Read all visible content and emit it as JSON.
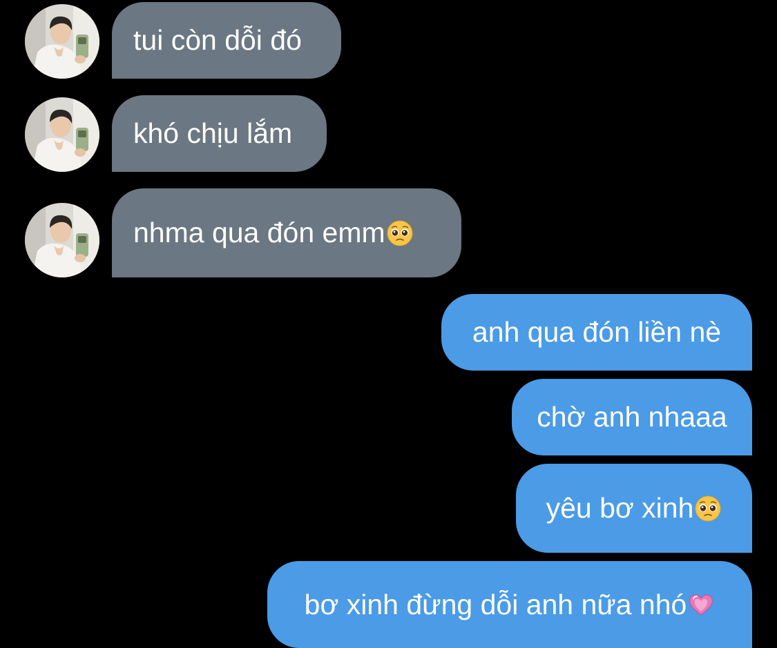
{
  "contact": {
    "avatar_icon": "profile-photo-avatar"
  },
  "messages": [
    {
      "direction": "incoming",
      "text": "tui còn dỗi đó"
    },
    {
      "direction": "incoming",
      "text": "khó chịu lắm"
    },
    {
      "direction": "incoming",
      "text": "nhma qua đón emm",
      "emoji": "pleading-face-icon"
    },
    {
      "direction": "outgoing",
      "text": "anh qua đón liền nè"
    },
    {
      "direction": "outgoing",
      "text": "chờ anh nhaaa"
    },
    {
      "direction": "outgoing",
      "text": "yêu bơ xinh",
      "emoji": "pleading-face-icon"
    },
    {
      "direction": "outgoing",
      "text": "bơ xinh đừng dỗi anh nữa nhó",
      "emoji": "pink-heart-icon"
    }
  ],
  "colors": {
    "background": "#000000",
    "incoming_bubble": "#6b7782",
    "outgoing_bubble": "#4b9be6",
    "text": "#ffffff"
  }
}
